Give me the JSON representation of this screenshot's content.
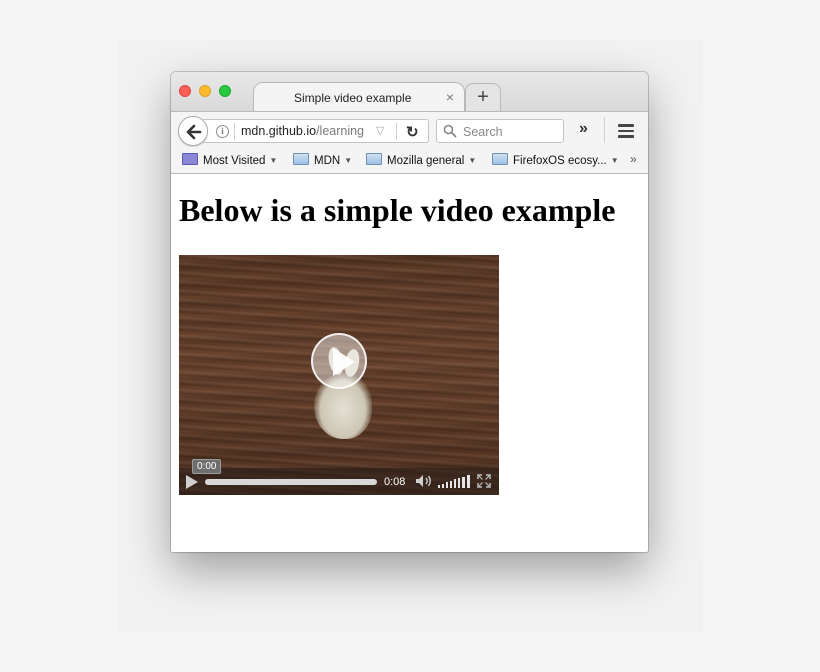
{
  "tab": {
    "title": "Simple video example",
    "close_glyph": "×",
    "new_tab_glyph": "+"
  },
  "navbar": {
    "url_host": "mdn.github.io",
    "url_path": "/learning",
    "search_placeholder": "Search",
    "overflow_glyph": "»"
  },
  "bookmarks": {
    "items": [
      {
        "label": "Most Visited",
        "icon": "most-visited-icon"
      },
      {
        "label": "MDN",
        "icon": "folder-icon"
      },
      {
        "label": "Mozilla general",
        "icon": "folder-icon"
      },
      {
        "label": "FirefoxOS ecosy...",
        "icon": "folder-icon"
      }
    ],
    "more_glyph": "»"
  },
  "page": {
    "heading": "Below is a simple video example"
  },
  "video": {
    "current_time": "0:00",
    "duration": "0:08",
    "progress": 0.0
  },
  "colors": {
    "close_light": "#fc5f57",
    "minimize_light": "#fdbc2e",
    "zoom_light": "#28c840"
  }
}
